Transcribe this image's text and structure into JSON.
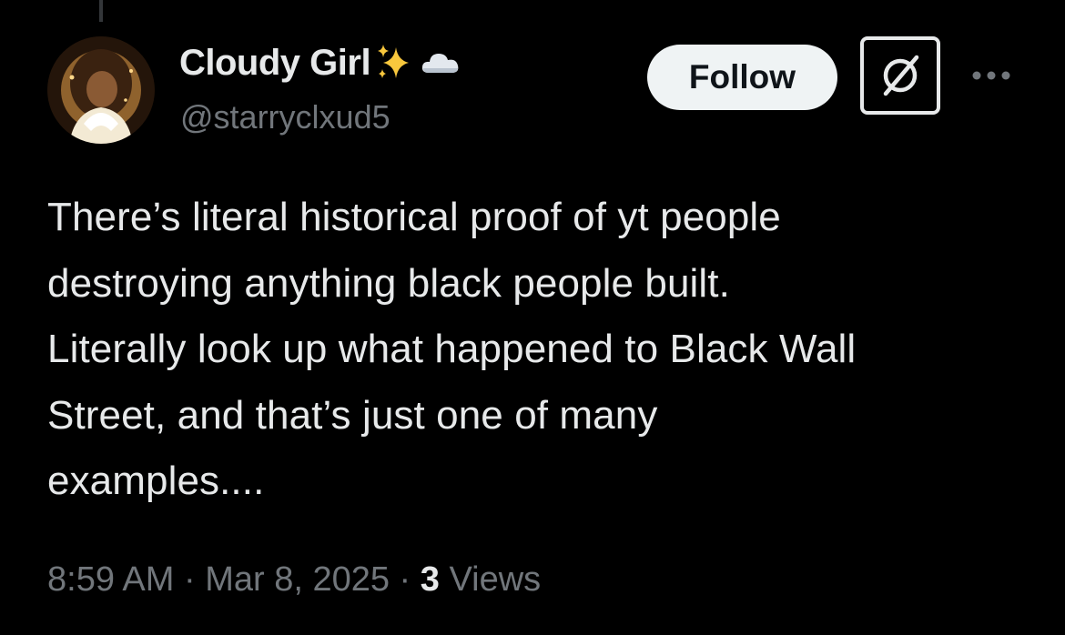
{
  "author": {
    "display_name": "Cloudy Girl",
    "handle": "@starryclxud5",
    "name_emojis": [
      "sparkles-emoji",
      "cloud-emoji"
    ]
  },
  "actions": {
    "follow_label": "Follow",
    "grok_icon": "grok-icon",
    "more_icon": "more-options-icon"
  },
  "tweet": {
    "text": "There’s literal historical proof of yt people\ndestroying anything black people built.\nLiterally look up what happened to Black Wall\nStreet, and that’s just one of many\nexamples...."
  },
  "meta": {
    "time": "8:59 AM",
    "separator": " · ",
    "date": "Mar 8, 2025",
    "views_count": "3",
    "views_label": " Views"
  },
  "colors": {
    "background": "#000000",
    "primary_text": "#e7e9ea",
    "secondary_text": "#71767b",
    "follow_button_bg": "#eff3f4",
    "follow_button_text": "#0f1419",
    "sparkle": "#f8c73d"
  }
}
